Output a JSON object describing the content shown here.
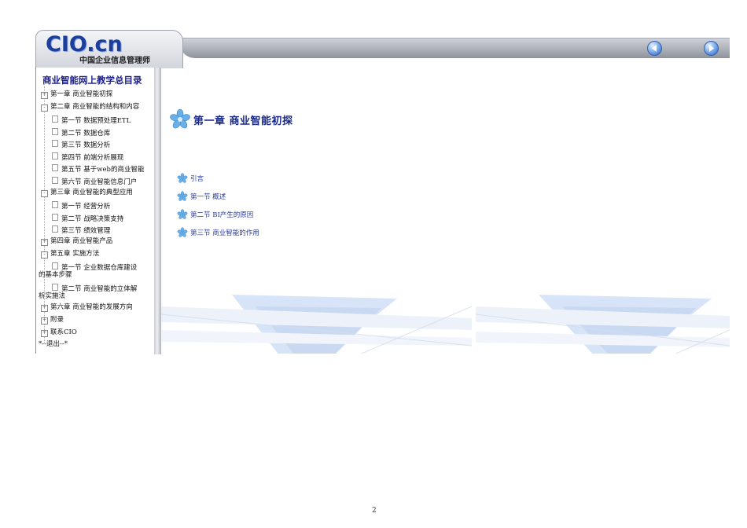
{
  "header": {
    "logo": "CIO.cn",
    "logo_subtitle": "中国企业信息管理师",
    "prev_icon": "prev-arrow-icon",
    "next_icon": "next-arrow-icon"
  },
  "sidebar": {
    "title": "商业智能网上教学总目录",
    "items": [
      {
        "label": "第一章 商业智能初探",
        "kind": "chapter"
      },
      {
        "label": "第二章 商业智能的结构和内容",
        "kind": "chapter"
      },
      {
        "label": "第一节 数据预处理ETL",
        "kind": "section"
      },
      {
        "label": "第二节 数据仓库",
        "kind": "section"
      },
      {
        "label": "第三节 数据分析",
        "kind": "section"
      },
      {
        "label": "第四节 前端分析展现",
        "kind": "section"
      },
      {
        "label": "第五节 基于web的商业智能",
        "kind": "section"
      },
      {
        "label": "第六节 商业智能信息门户",
        "kind": "section"
      },
      {
        "label": "第三章 商业智能的典型应用",
        "kind": "chapter"
      },
      {
        "label": "第一节 经营分析",
        "kind": "section"
      },
      {
        "label": "第二节 战略决策支持",
        "kind": "section"
      },
      {
        "label": "第三节 绩效管理",
        "kind": "section"
      },
      {
        "label": "第四章 商业智能产品",
        "kind": "chapter"
      },
      {
        "label": "第五章 实施方法",
        "kind": "chapter"
      },
      {
        "label": "第一节 企业数据仓库建设",
        "label2": "的基本步骤",
        "kind": "section"
      },
      {
        "label": "第二节 商业智能的立体解",
        "label2": "析实施法",
        "kind": "section"
      },
      {
        "label": "第六章 商业智能的发展方向",
        "kind": "chapter"
      },
      {
        "label": "附录",
        "kind": "chapter"
      },
      {
        "label": "联系CIO",
        "kind": "chapter"
      },
      {
        "label": "*--退出--*",
        "kind": "exit"
      }
    ]
  },
  "content": {
    "chapter_title": "第一章 商业智能初探",
    "links": [
      {
        "label": "引言"
      },
      {
        "label": "第一节 概述"
      },
      {
        "label": "第二节 BI产生的原因"
      },
      {
        "label": "第三节 商业智能的作用"
      }
    ],
    "star_icon": "star-bullet-icon"
  },
  "page_number": "2",
  "colors": {
    "title_blue": "#1a2a8a",
    "link_blue": "#2a3b9a",
    "bar_gray": "#a8acb4"
  }
}
